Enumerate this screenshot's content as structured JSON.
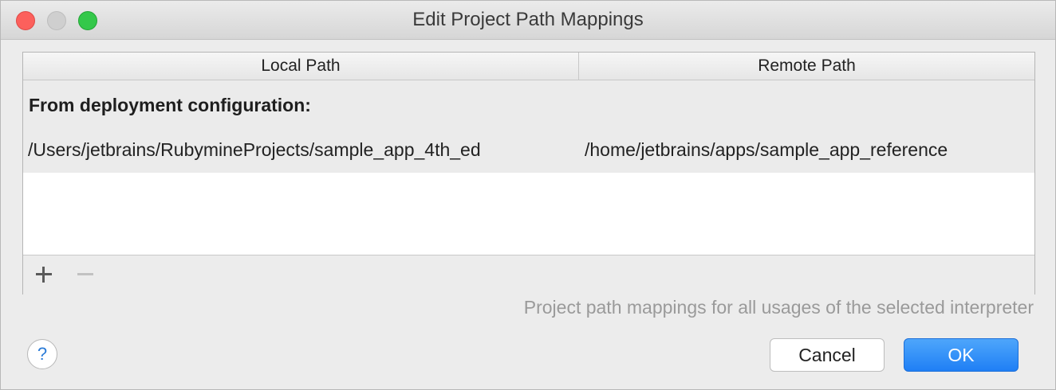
{
  "window": {
    "title": "Edit Project Path Mappings"
  },
  "table": {
    "columns": [
      "Local Path",
      "Remote Path"
    ],
    "group_label": "From deployment configuration:",
    "rows": [
      {
        "local": "/Users/jetbrains/RubymineProjects/sample_app_4th_ed",
        "remote": "/home/jetbrains/apps/sample_app_reference"
      }
    ]
  },
  "toolbar": {
    "add_icon": "plus-icon",
    "remove_icon": "minus-icon"
  },
  "hint": "Project path mappings for all usages of the selected interpreter",
  "help": {
    "label": "?"
  },
  "buttons": {
    "cancel": "Cancel",
    "ok": "OK"
  },
  "colors": {
    "accent": "#1f7ff5",
    "close": "#fc605c",
    "maximize": "#34c84a"
  }
}
